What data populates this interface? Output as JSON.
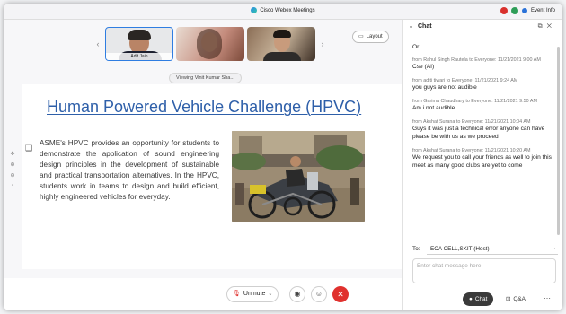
{
  "window": {
    "title": "Cisco Webex Meetings",
    "event_info": "Event Info",
    "status_colors": {
      "red": "#d9302c",
      "green": "#2e9d57",
      "blue": "#2b72d8"
    }
  },
  "thumbnails": [
    {
      "name": "Adit Jain"
    },
    {
      "name": ""
    },
    {
      "name": ""
    }
  ],
  "layout_button": "Layout",
  "viewing_label": "Viewing Vinit Kumar Sha...",
  "slide": {
    "title": "Human Powered Vehicle Challenge (HPVC)",
    "body": "ASME's HPVC provides an opportunity for students to demonstrate the application of sound engineering design principles in the development of sustainable and practical transportation alternatives. In the HPVC, students work in teams to design and build efficient, highly engineered vehicles for everyday.",
    "title_color": "#2e5fa9"
  },
  "controls": {
    "unmute_label": "Unmute",
    "mic_icon": "mic-muted-icon",
    "end_color": "#e0312e"
  },
  "chat": {
    "title": "Chat",
    "messages": [
      {
        "meta": "",
        "text": "Or"
      },
      {
        "meta": "from Rahul Singh Rautela to Everyone: 11/21/2021 9:00 AM",
        "text": "Cse (AI)"
      },
      {
        "meta": "from aditi tiwari to Everyone: 11/21/2021 9:24 AM",
        "text": "you guys are not audible"
      },
      {
        "meta": "from Garima Chaudhary to Everyone: 11/21/2021 9:50 AM",
        "text": "Am i not audible"
      },
      {
        "meta": "from Akshat Surana to Everyone: 11/21/2021 10:04 AM",
        "text": "Guys it was just a technical error anyone can have please be with us as we proceed"
      },
      {
        "meta": "from Akshat Surana to Everyone: 11/21/2021 10:20 AM",
        "text": "We request you to call your friends as well to join this meet as many good clubs are yet to come"
      }
    ],
    "to_label": "To:",
    "recipient": "ECA CELL,SKIT (Host)",
    "input_placeholder": "Enter chat message here",
    "chat_tab": "Chat",
    "qa_tab": "Q&A"
  }
}
